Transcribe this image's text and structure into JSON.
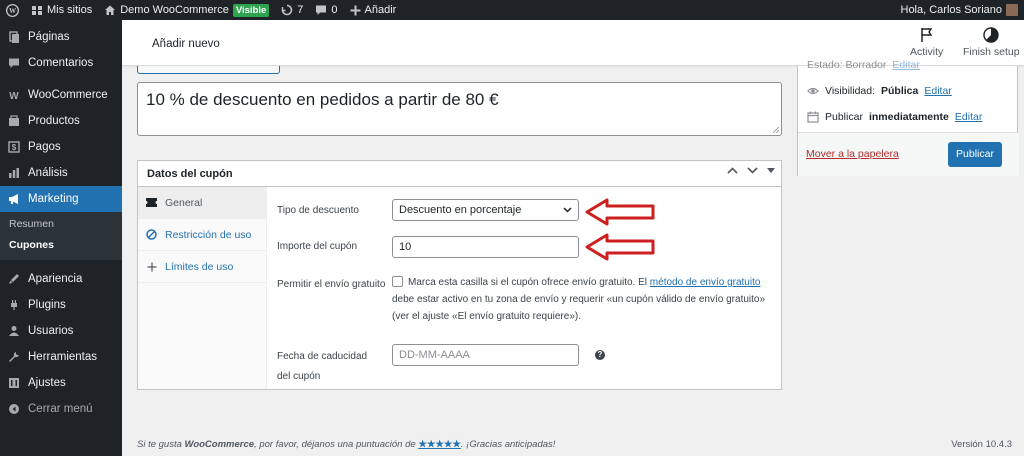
{
  "adminbar": {
    "my_sites": "Mis sitios",
    "site_name": "Demo WooCommerce",
    "visibility_badge": "Visible",
    "updates_count": "7",
    "comments_count": "0",
    "add_new": "Añadir",
    "greeting": "Hola, Carlos Soriano"
  },
  "sidebar": {
    "items": [
      {
        "label": "Páginas",
        "icon": "pages-icon"
      },
      {
        "label": "Comentarios",
        "icon": "comments-icon"
      },
      {
        "label": "WooCommerce",
        "icon": "woocommerce-icon"
      },
      {
        "label": "Productos",
        "icon": "products-icon"
      },
      {
        "label": "Pagos",
        "icon": "payments-icon"
      },
      {
        "label": "Análisis",
        "icon": "analytics-icon"
      },
      {
        "label": "Marketing",
        "icon": "marketing-icon"
      },
      {
        "label": "Apariencia",
        "icon": "appearance-icon"
      },
      {
        "label": "Plugins",
        "icon": "plugins-icon"
      },
      {
        "label": "Usuarios",
        "icon": "users-icon"
      },
      {
        "label": "Herramientas",
        "icon": "tools-icon"
      },
      {
        "label": "Ajustes",
        "icon": "settings-icon"
      },
      {
        "label": "Cerrar menú",
        "icon": "collapse-icon"
      }
    ],
    "submenu": [
      "Resumen",
      "Cupones"
    ]
  },
  "header": {
    "title": "Añadir nuevo",
    "activity": "Activity",
    "finish_setup": "Finish setup"
  },
  "coupon_title": "10 % de descuento en pedidos a partir de 80 €",
  "coupon_box": {
    "heading": "Datos del cupón",
    "tabs": [
      "General",
      "Restricción de uso",
      "Límites de uso"
    ],
    "discount_type_label": "Tipo de descuento",
    "discount_type_value": "Descuento en porcentaje",
    "amount_label": "Importe del cupón",
    "amount_value": "10",
    "free_shipping_label": "Permitir el envío gratuito",
    "free_shipping_desc_1": "Marca esta casilla si el cupón ofrece envío gratuito. El",
    "free_shipping_link": "método de envío gratuito",
    "free_shipping_desc_2": "debe estar activo en tu zona de envío y requerir «un cupón válido de envío gratuito»",
    "free_shipping_desc_3": "(ver el ajuste «El envío gratuito requiere»).",
    "expiry_label_1": "Fecha de caducidad",
    "expiry_label_2": "del cupón",
    "expiry_placeholder": "DD-MM-AAAA"
  },
  "publish": {
    "status_partial": "Estado: Borrador",
    "status_edit": "Editar",
    "visibility_label": "Visibilidad:",
    "visibility_value": "Pública",
    "visibility_edit": "Editar",
    "publish_label": "Publicar",
    "publish_value": "inmediatamente",
    "publish_edit": "Editar",
    "trash": "Mover a la papelera",
    "publish_button": "Publicar"
  },
  "footer": {
    "text_1": "Si te gusta",
    "brand": "WooCommerce",
    "text_2": ", por favor, déjanos una puntuación de",
    "stars": "★★★★★",
    "text_3": ". ¡Gracias anticipadas!",
    "version": "Versión 10.4.3"
  },
  "colors": {
    "admin_dark": "#1d2327",
    "accent": "#2271b1",
    "arrow": "#cc1f1f"
  }
}
